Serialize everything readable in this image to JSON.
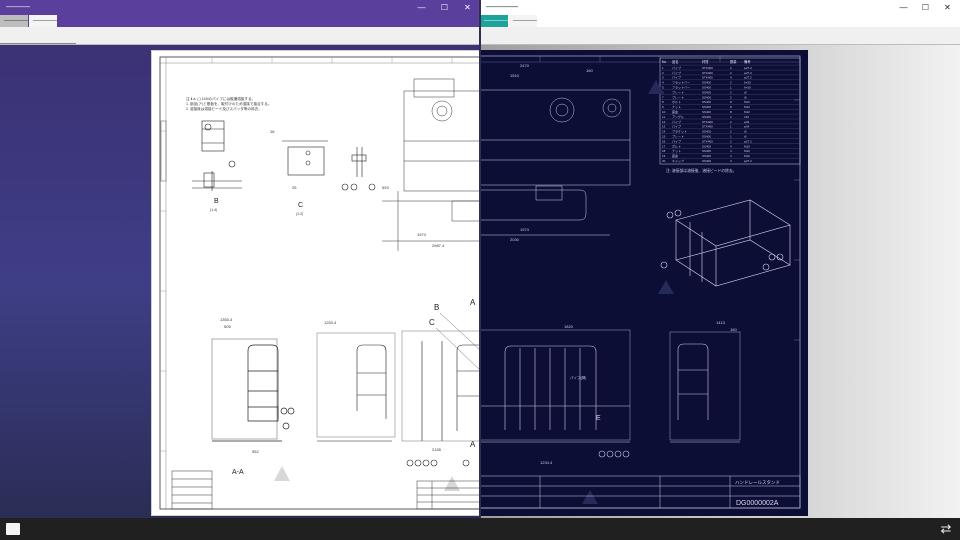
{
  "left_window": {
    "title": "———",
    "tabs": [
      {
        "label": "————"
      },
      {
        "label": "————"
      }
    ],
    "controls": {
      "minimize": "—",
      "maximize": "☐",
      "close": "✕"
    },
    "drawing": {
      "note_line_1": "注 Ⅱ.a. ( ) 11Mのパイプには縦通溶接する。",
      "note_line_2": "1. 部品(ア)と基板を、取付けのため溶接で接合する。",
      "note_line_3": "2. 溶接後は溶接ビード及びスパッタ等の除去。",
      "view_b_label": "B",
      "view_b_scale": "(1:4)",
      "view_c_label": "C",
      "view_c_scale": "(1:2)",
      "section_label": "A-A",
      "dim_1353": "1353.4",
      "dim_1253": "1253.4",
      "dim_1974": "1974",
      "dim_2987": "2987.4",
      "dim_505": "505",
      "dim_952": "952",
      "dim_2155": "2155",
      "dim_593": "593",
      "dim_1000": "1000",
      "dim_378": "378",
      "dim_120": "120",
      "dim_60": "60",
      "dim_25": "25",
      "dim_16": "16",
      "letter_a": "A",
      "letter_b": "B",
      "letter_c": "C"
    }
  },
  "right_window": {
    "title": "————",
    "tabs": [
      {
        "label": "————"
      },
      {
        "label": "————"
      }
    ],
    "controls": {
      "minimize": "—",
      "maximize": "☐",
      "close": "✕"
    },
    "drawing": {
      "dim_2470": "2470",
      "dim_1510": "1510",
      "dim_160": "160",
      "dim_1820": "1820",
      "dim_1234": "1234.4",
      "dim_2030": "2030",
      "dim_1974": "1974",
      "dim_1413": "1413",
      "dim_160b": "160",
      "label_pipe": "パイプ(脚)",
      "label_note": "注: 溶接部は溶接後、溶接ビードの除去。",
      "title_block_name": "ハンドレールスタンド",
      "drawing_number": "DG0000002A",
      "letter_e": "E"
    },
    "parts_table": {
      "headers": [
        "No",
        "品名",
        "材質",
        "数量",
        "備考"
      ],
      "rows": [
        [
          "1",
          "パイプ",
          "STK400",
          "2",
          "φ27.2"
        ],
        [
          "2",
          "パイプ",
          "STK400",
          "2",
          "φ27.2"
        ],
        [
          "3",
          "パイプ",
          "STK400",
          "4",
          "φ27.2"
        ],
        [
          "4",
          "フラットバー",
          "SS400",
          "2",
          "6×50"
        ],
        [
          "5",
          "フラットバー",
          "SS400",
          "1",
          "6×50"
        ],
        [
          "6",
          "プレート",
          "SS400",
          "2",
          "t9"
        ],
        [
          "7",
          "プレート",
          "SS400",
          "2",
          "t9"
        ],
        [
          "8",
          "ボルト",
          "SS400",
          "8",
          "M12"
        ],
        [
          "9",
          "ナット",
          "SS400",
          "8",
          "M12"
        ],
        [
          "10",
          "座金",
          "SS400",
          "8",
          "M12"
        ],
        [
          "11",
          "アングル",
          "SS400",
          "2",
          "L50"
        ],
        [
          "12",
          "パイプ",
          "STK400",
          "2",
          "φ34"
        ],
        [
          "13",
          "パイプ",
          "STK400",
          "1",
          "φ34"
        ],
        [
          "14",
          "ブラケット",
          "SS400",
          "2",
          "t6"
        ],
        [
          "15",
          "プレート",
          "SS400",
          "1",
          "t6"
        ],
        [
          "16",
          "パイプ",
          "STK400",
          "2",
          "φ27.2"
        ],
        [
          "17",
          "ボルト",
          "SS400",
          "4",
          "M10"
        ],
        [
          "18",
          "ナット",
          "SS400",
          "4",
          "M10"
        ],
        [
          "19",
          "座金",
          "SS400",
          "4",
          "M10"
        ],
        [
          "20",
          "キャップ",
          "SS400",
          "4",
          "φ27.2"
        ]
      ]
    }
  },
  "taskbar": {
    "start_icon": "windows-logo-icon",
    "swap_icon": "swap-arrows-icon",
    "swap_glyph": "⇄"
  }
}
